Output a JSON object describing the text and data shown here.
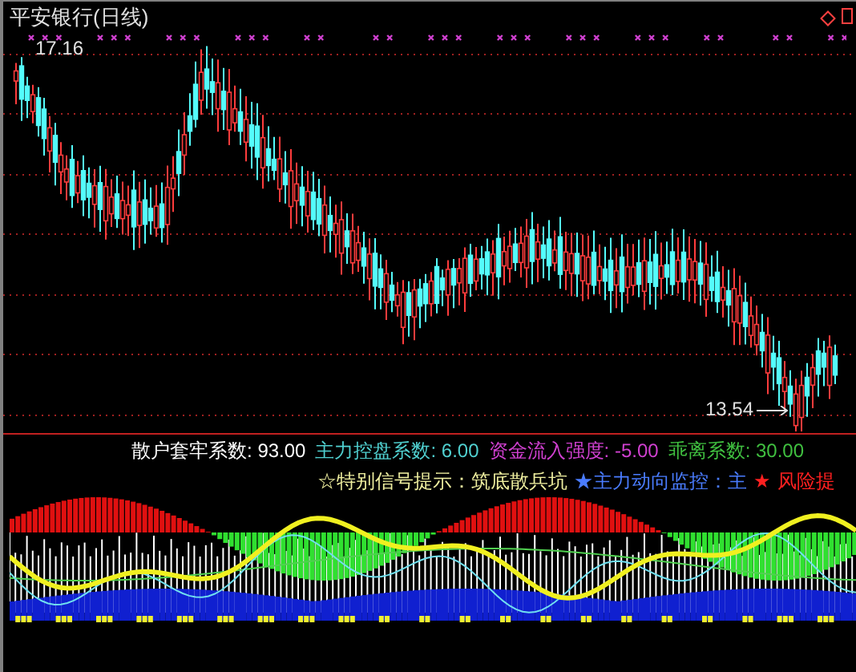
{
  "chart": {
    "title": "平安银行(日线)",
    "high_label": "17.16",
    "low_label": "13.54"
  },
  "indicator": {
    "values": [
      {
        "label": "散户套牢系数:",
        "value": "93.00",
        "color": "#ffffff"
      },
      {
        "label": "主力控盘系数:",
        "value": "6.00",
        "color": "#50d0d0"
      },
      {
        "label": "资金流入强度:",
        "value": "-5.00",
        "color": "#d040d0"
      },
      {
        "label": "乖离系数:",
        "value": "30.00",
        "color": "#40c040"
      }
    ],
    "signals": [
      {
        "text": "☆特别信号提示：筑底散兵坑",
        "color": "#f0f0a0"
      },
      {
        "text": "★主力动向监控：主",
        "color": "#4a7cff"
      },
      {
        "text": "★",
        "color": "#ff2020"
      },
      {
        "text": "风险提",
        "color": "#ff2020"
      }
    ]
  }
}
